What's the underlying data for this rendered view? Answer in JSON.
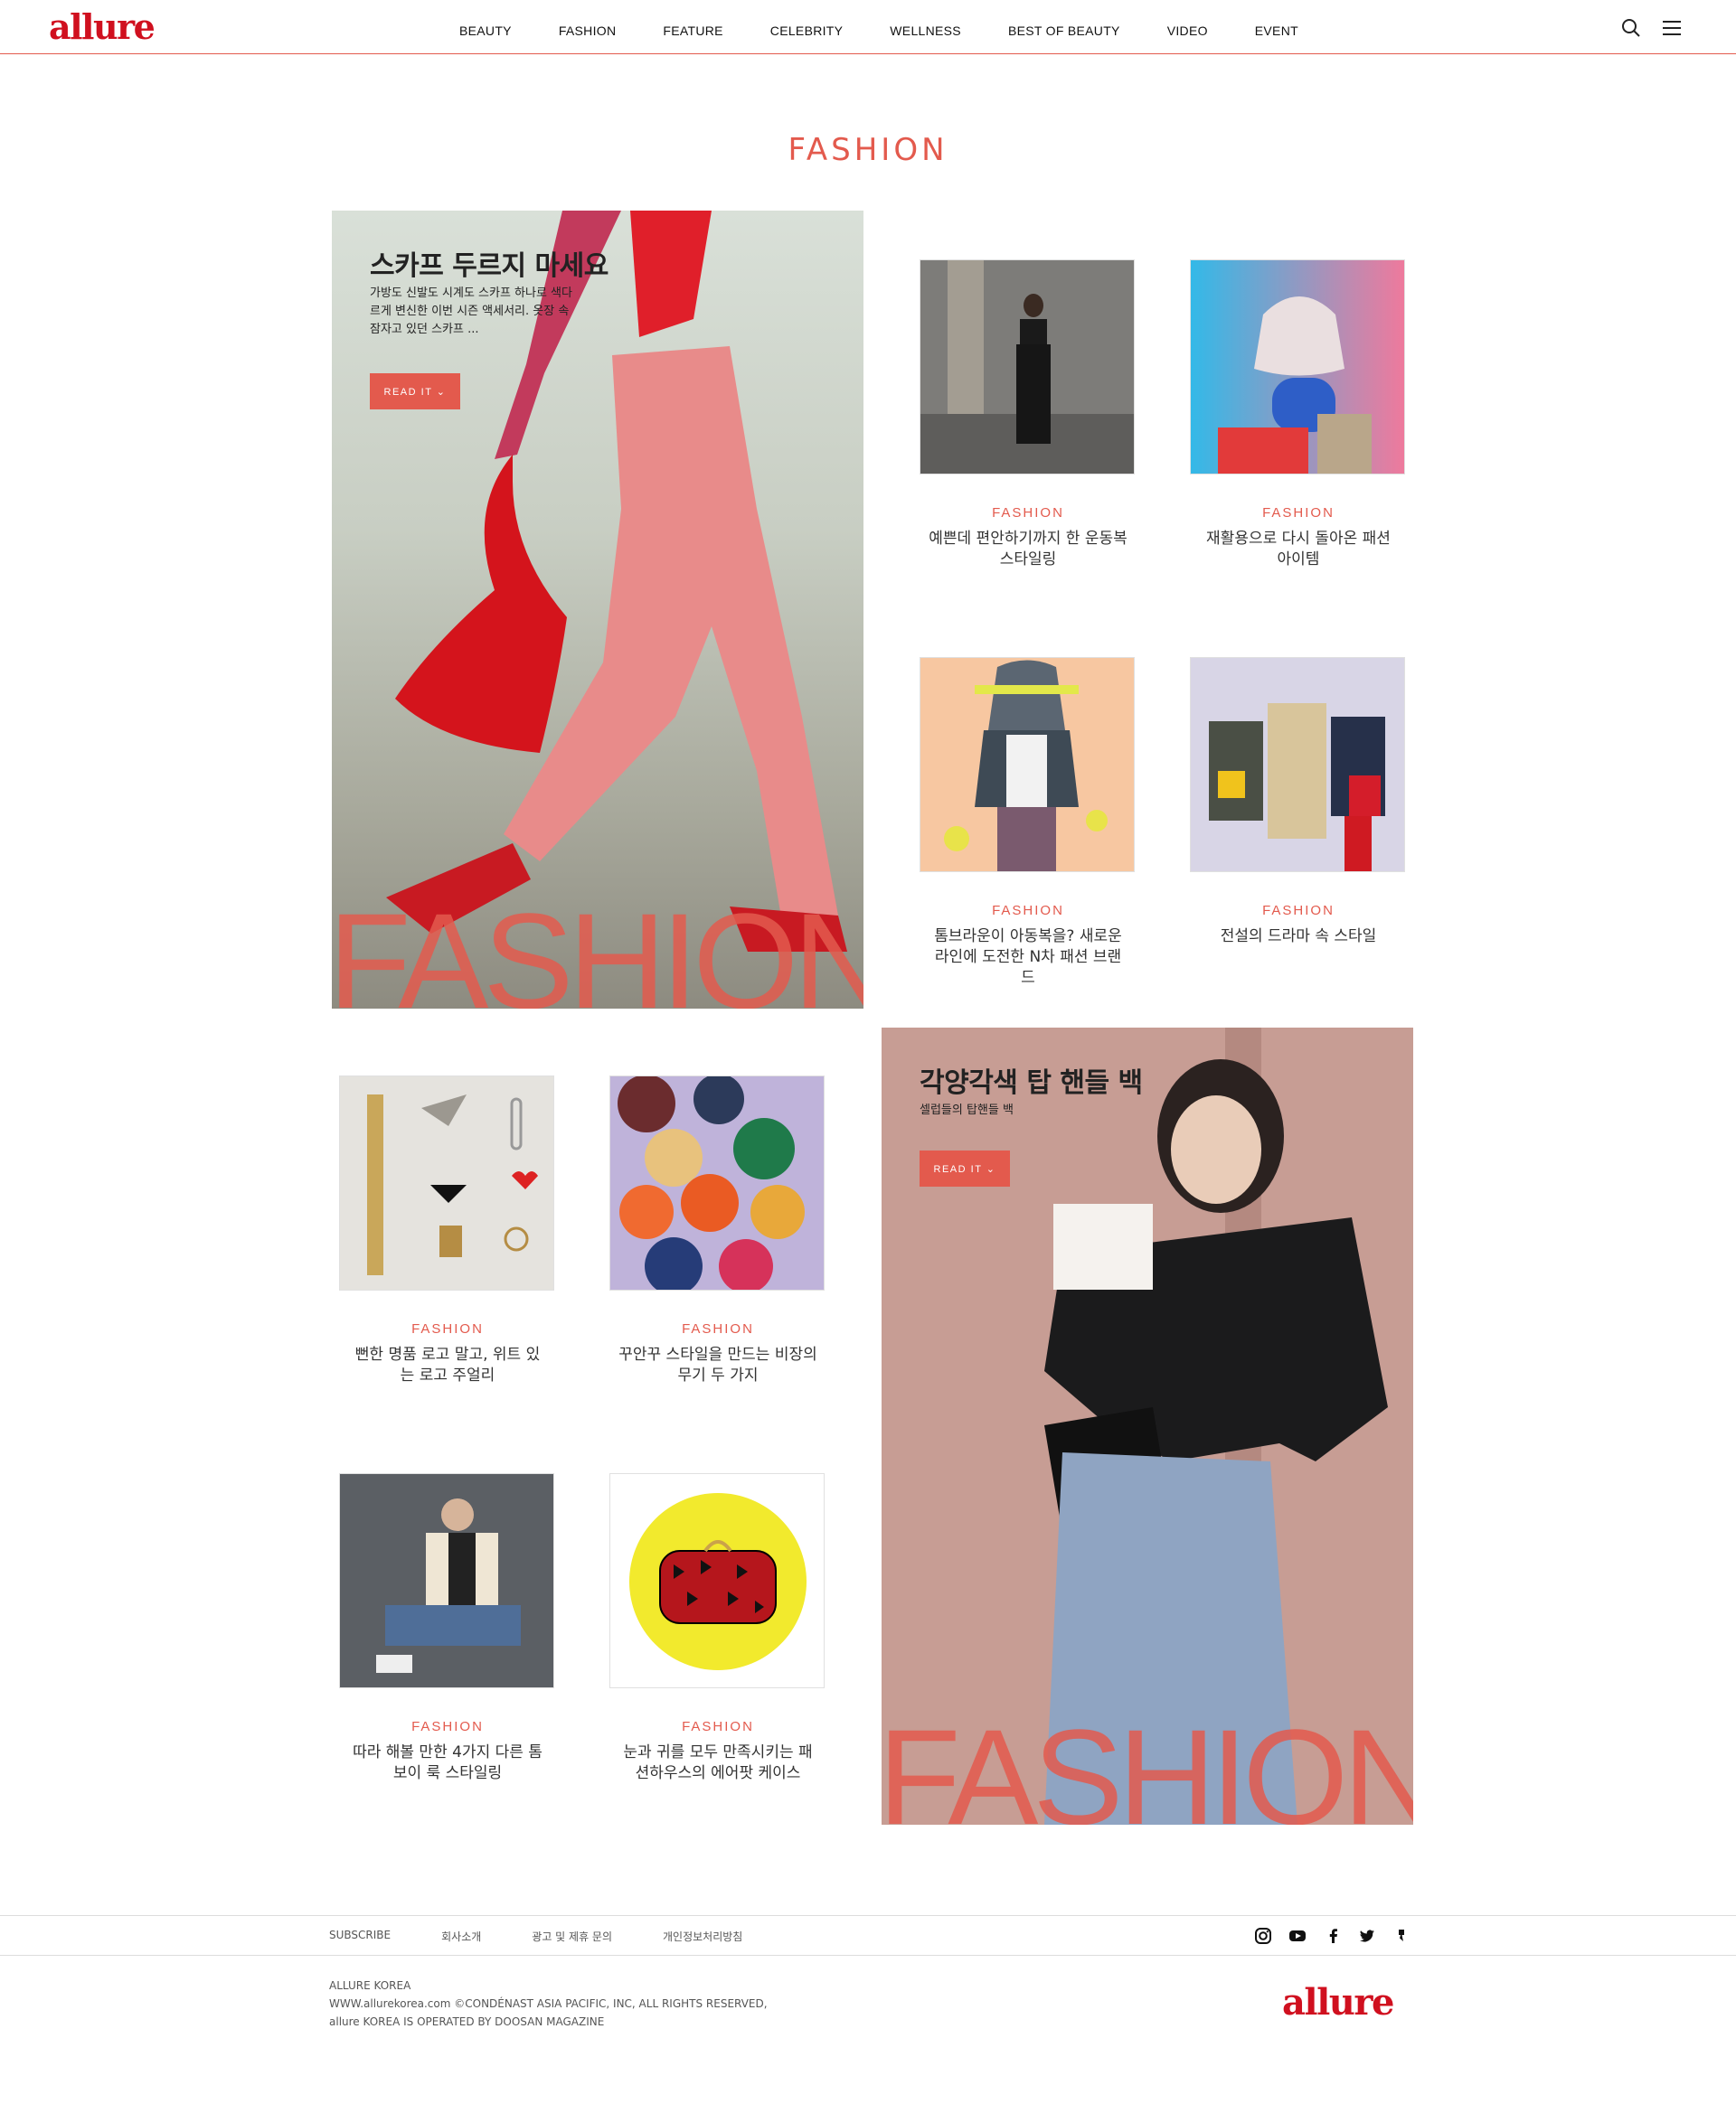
{
  "header": {
    "logo": "allure",
    "nav": [
      "BEAUTY",
      "FASHION",
      "FEATURE",
      "CELEBRITY",
      "WELLNESS",
      "BEST OF BEAUTY",
      "VIDEO",
      "EVENT"
    ]
  },
  "page": {
    "title": "FASHION"
  },
  "features": [
    {
      "title": "스카프 두르지 마세요",
      "desc": "가방도 신발도 시계도 스카프 하나로 색다르게 변신한 이번 시즌 액세서리. 옷장 속 잠자고 있던 스카프 ...",
      "button": "READ IT ⌄",
      "watermark": "FASHION"
    },
    {
      "title": "각양각색 탑 핸들 백",
      "desc": "셀럽들의 탑핸들 백",
      "button": "READ IT ⌄",
      "watermark": "FASHION"
    }
  ],
  "cards": [
    {
      "category": "FASHION",
      "title": "예쁜데 편안하기까지 한 운동복 스타일링"
    },
    {
      "category": "FASHION",
      "title": "재활용으로 다시 돌아온 패션 아이템"
    },
    {
      "category": "FASHION",
      "title": "톰브라운이 아동복을? 새로운 라인에 도전한 N차 패션 브랜드"
    },
    {
      "category": "FASHION",
      "title": "전설의 드라마 속 스타일"
    },
    {
      "category": "FASHION",
      "title": "뻔한 명품 로고 말고, 위트 있는 로고 주얼리"
    },
    {
      "category": "FASHION",
      "title": "꾸안꾸 스타일을 만드는 비장의 무기 두 가지"
    },
    {
      "category": "FASHION",
      "title": "따라 해볼 만한 4가지 다른 톰보이 룩 스타일링"
    },
    {
      "category": "FASHION",
      "title": "눈과 귀를 모두 만족시키는 패션하우스의 에어팟 케이스"
    }
  ],
  "footer": {
    "links": [
      "SUBSCRIBE",
      "회사소개",
      "광고 및 제휴 문의",
      "개인정보처리방침"
    ],
    "social_icons": [
      "instagram-icon",
      "youtube-icon",
      "facebook-icon",
      "twitter-icon",
      "kakao-story-icon"
    ],
    "company": "ALLURE KOREA",
    "copyright": "WWW.allurekorea.com ©CONDÉNAST ASIA PACIFIC, INC, ALL RIGHTS RESERVED,",
    "operated": "allure KOREA IS OPERATED BY DOOSAN MAGAZINE",
    "logo": "allure"
  },
  "colors": {
    "accent": "#e35a4d",
    "brand": "#d0101f"
  }
}
